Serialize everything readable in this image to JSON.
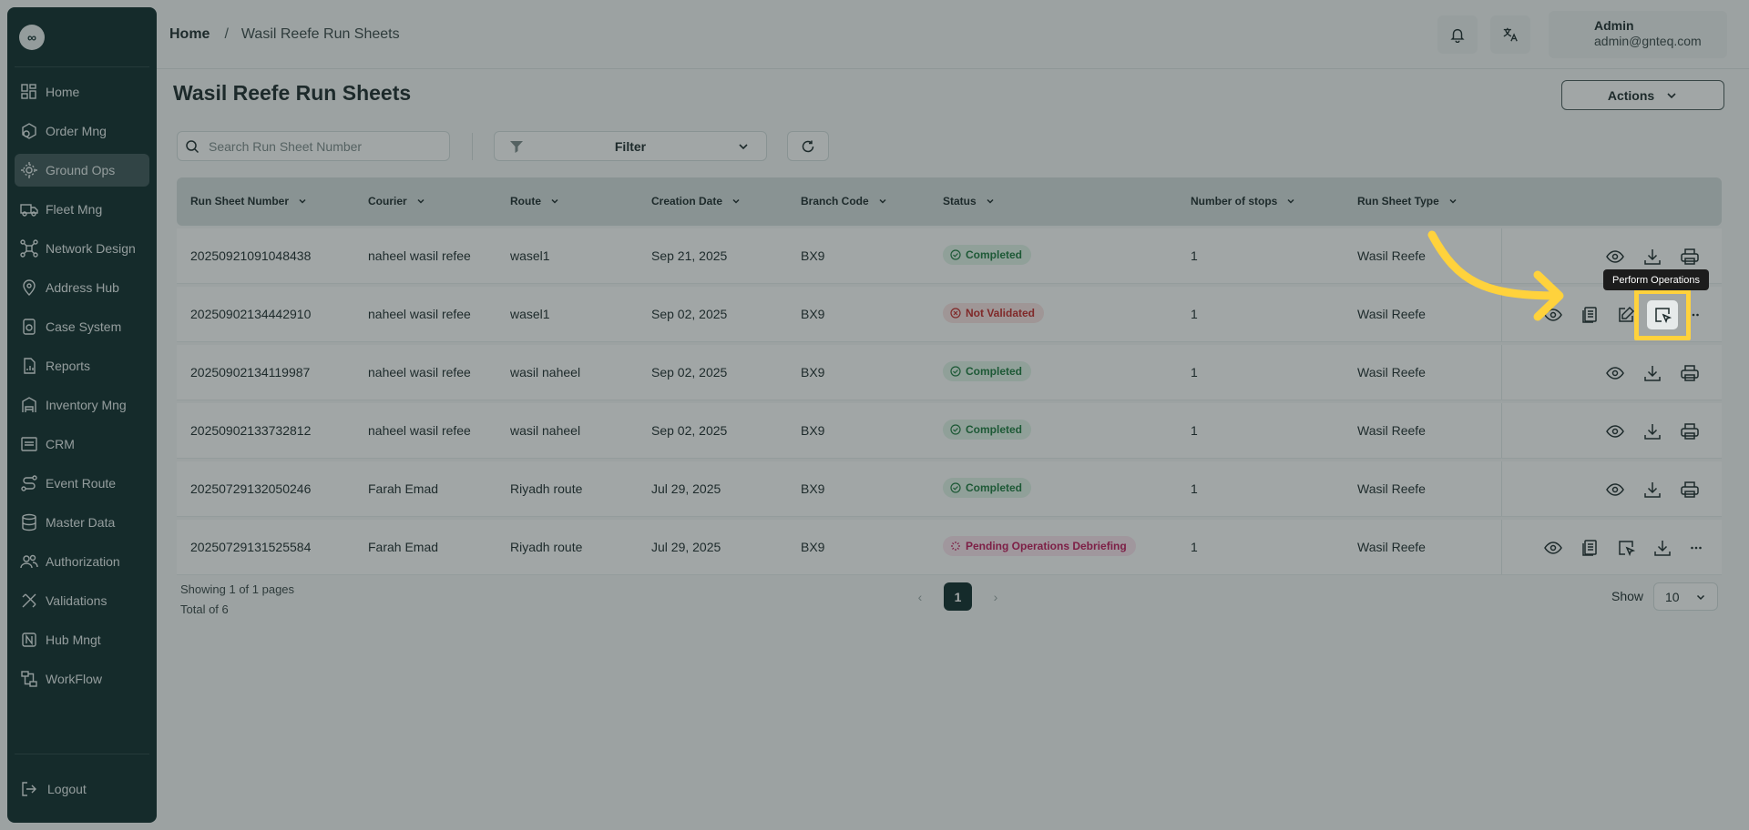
{
  "sidebar": {
    "logo_glyph": "∞",
    "items": [
      {
        "label": "Home",
        "icon": "home-icon"
      },
      {
        "label": "Order Mng",
        "icon": "order-icon"
      },
      {
        "label": "Ground Ops",
        "icon": "ground-ops-icon",
        "active": true
      },
      {
        "label": "Fleet Mng",
        "icon": "truck-icon"
      },
      {
        "label": "Network Design",
        "icon": "network-icon"
      },
      {
        "label": "Address Hub",
        "icon": "map-pin-icon"
      },
      {
        "label": "Case System",
        "icon": "case-icon"
      },
      {
        "label": "Reports",
        "icon": "report-icon"
      },
      {
        "label": "Inventory Mng",
        "icon": "inventory-icon"
      },
      {
        "label": "CRM",
        "icon": "crm-icon"
      },
      {
        "label": "Event Route",
        "icon": "route-icon"
      },
      {
        "label": "Master Data",
        "icon": "database-icon"
      },
      {
        "label": "Authorization",
        "icon": "users-icon"
      },
      {
        "label": "Validations",
        "icon": "validation-icon"
      },
      {
        "label": "Hub Mngt",
        "icon": "hub-icon"
      },
      {
        "label": "WorkFlow",
        "icon": "workflow-icon"
      }
    ],
    "logout_label": "Logout"
  },
  "header": {
    "breadcrumb_home": "Home",
    "breadcrumb_sep": "/",
    "breadcrumb_current": "Wasil Reefe Run Sheets",
    "user_name": "Admin",
    "user_email": "admin@gnteq.com"
  },
  "page": {
    "title": "Wasil Reefe Run Sheets",
    "actions_label": "Actions"
  },
  "toolbar": {
    "search_placeholder": "Search Run Sheet Number",
    "filter_label": "Filter"
  },
  "table": {
    "columns": [
      "Run Sheet Number",
      "Courier",
      "Route",
      "Creation Date",
      "Branch Code",
      "Status",
      "Number of stops",
      "Run Sheet Type"
    ],
    "rows": [
      {
        "number": "20250921091048438",
        "courier": "naheel wasil refee",
        "route": "wasel1",
        "date": "Sep 21, 2025",
        "branch": "BX9",
        "status": "Completed",
        "stops": "1",
        "type": "Wasil Reefe"
      },
      {
        "number": "20250902134442910",
        "courier": "naheel wasil refee",
        "route": "wasel1",
        "date": "Sep 02, 2025",
        "branch": "BX9",
        "status": "Not Validated",
        "stops": "1",
        "type": "Wasil Reefe"
      },
      {
        "number": "20250902134119987",
        "courier": "naheel wasil refee",
        "route": "wasil naheel",
        "date": "Sep 02, 2025",
        "branch": "BX9",
        "status": "Completed",
        "stops": "1",
        "type": "Wasil Reefe"
      },
      {
        "number": "20250902133732812",
        "courier": "naheel wasil refee",
        "route": "wasil naheel",
        "date": "Sep 02, 2025",
        "branch": "BX9",
        "status": "Completed",
        "stops": "1",
        "type": "Wasil Reefe"
      },
      {
        "number": "20250729132050246",
        "courier": "Farah Emad",
        "route": "Riyadh route",
        "date": "Jul 29, 2025",
        "branch": "BX9",
        "status": "Completed",
        "stops": "1",
        "type": "Wasil Reefe"
      },
      {
        "number": "20250729131525584",
        "courier": "Farah Emad",
        "route": "Riyadh route",
        "date": "Jul 29, 2025",
        "branch": "BX9",
        "status": "Pending Operations Debriefing",
        "stops": "1",
        "type": "Wasil Reefe"
      }
    ]
  },
  "footer": {
    "showing": "Showing 1 of 1 pages",
    "total": "Total of 6",
    "current_page": "1",
    "show_label": "Show",
    "page_size": "10"
  },
  "tooltip": {
    "text": "Perform Operations"
  },
  "colors": {
    "sidebar_bg": "#0f2b2c",
    "highlight": "#ffd23c",
    "completed": "#1d7a3f",
    "not_validated": "#c62828",
    "pending": "#c2185b"
  }
}
